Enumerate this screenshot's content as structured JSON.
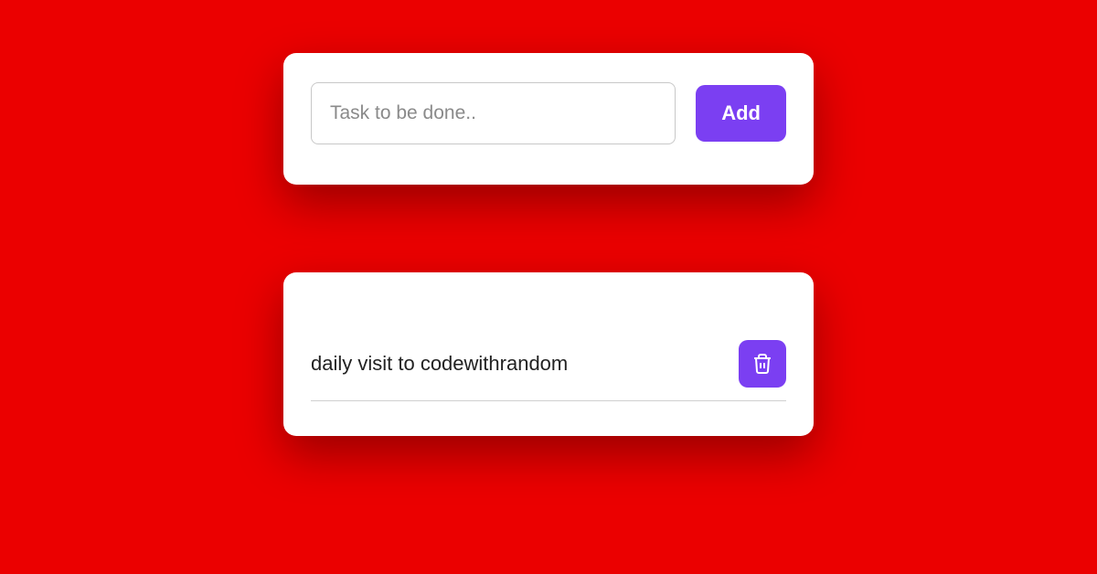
{
  "input": {
    "placeholder": "Task to be done..",
    "value": ""
  },
  "buttons": {
    "add_label": "Add"
  },
  "tasks": [
    {
      "text": "daily visit to codewithrandom"
    }
  ],
  "colors": {
    "background": "#eb0000",
    "accent": "#7b3ff2",
    "card": "#ffffff"
  }
}
